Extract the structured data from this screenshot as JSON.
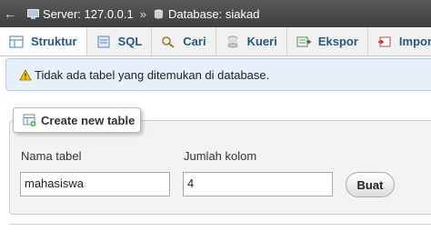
{
  "breadcrumb": {
    "server": "Server: 127.0.0.1",
    "separator": "»",
    "database": "Database: siakad"
  },
  "tabs": [
    {
      "label": "Struktur",
      "icon": "structure-icon",
      "active": true
    },
    {
      "label": "SQL",
      "icon": "sql-icon",
      "active": false
    },
    {
      "label": "Cari",
      "icon": "search-icon",
      "active": false
    },
    {
      "label": "Kueri",
      "icon": "query-icon",
      "active": false
    },
    {
      "label": "Ekspor",
      "icon": "export-icon",
      "active": false
    },
    {
      "label": "Impor",
      "icon": "import-icon",
      "active": false
    }
  ],
  "notice": {
    "text": "Tidak ada tabel yang ditemukan di database.",
    "icon": "warning-icon"
  },
  "create_table": {
    "legend": "Create new table",
    "name_label": "Nama tabel",
    "name_value": "mahasiswa",
    "columns_label": "Jumlah kolom",
    "columns_value": "4",
    "submit_label": "Buat"
  },
  "colors": {
    "topbar": "#4a4a4a",
    "tab_text": "#235a81",
    "notice_bg": "#e7f0f8",
    "panel_bg": "#f3f3f3"
  }
}
